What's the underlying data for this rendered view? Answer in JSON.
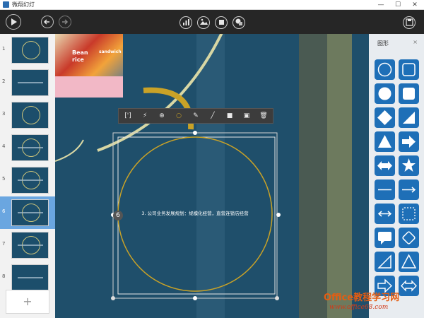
{
  "app": {
    "title": "微翔幻灯",
    "window_controls": [
      "—",
      "☐",
      "✕"
    ]
  },
  "toolbar": {
    "play_icon": "play-icon",
    "undo_icon": "undo-icon",
    "redo_icon": "redo-icon",
    "center_icons": [
      "chart-icon",
      "image-icon",
      "stop-icon",
      "shape-icon"
    ],
    "save_icon": "save-icon"
  },
  "thumbnails": [
    {
      "num": "1"
    },
    {
      "num": "2"
    },
    {
      "num": "3"
    },
    {
      "num": "4"
    },
    {
      "num": "5"
    },
    {
      "num": "6",
      "selected": true
    },
    {
      "num": "7"
    },
    {
      "num": "8"
    }
  ],
  "add_slide_label": "+",
  "slide": {
    "photo_text": [
      "Bean",
      "rice",
      "sandwich"
    ],
    "selected_text": "3. 公司业务发展规划：规模化经营，直营连锁店经营",
    "badge": "6"
  },
  "object_toolbar": {
    "buttons": [
      "[']",
      "⚡",
      "⊕",
      "○",
      "✎",
      "╱",
      "■",
      "▣",
      "🗑"
    ]
  },
  "shapes_panel": {
    "title": "图形",
    "close": "×",
    "shapes": [
      "circle-outline-shape",
      "rounded-square-outline-shape",
      "circle-shape",
      "rounded-square-shape",
      "diamond-shape",
      "right-triangle-shape",
      "triangle-shape",
      "right-arrow-shape",
      "double-arrow-shape",
      "star-shape",
      "line-shape",
      "line-arrow-shape",
      "double-line-arrow-shape",
      "dashed-square-shape",
      "speech-bubble-shape",
      "rounded-diamond-shape",
      "right-triangle-outline-shape",
      "triangle-outline-shape",
      "right-arrow-outline-shape",
      "double-arrow-outline-shape"
    ]
  },
  "watermark": {
    "main": "Office教程学习网",
    "url": "www.office68.com"
  },
  "colors": {
    "slide_bg": "#1f4f6b",
    "accent_gold": "#c9a227",
    "selection_blue": "#6aa6e0",
    "shape_blue": "#1e6fb7"
  }
}
